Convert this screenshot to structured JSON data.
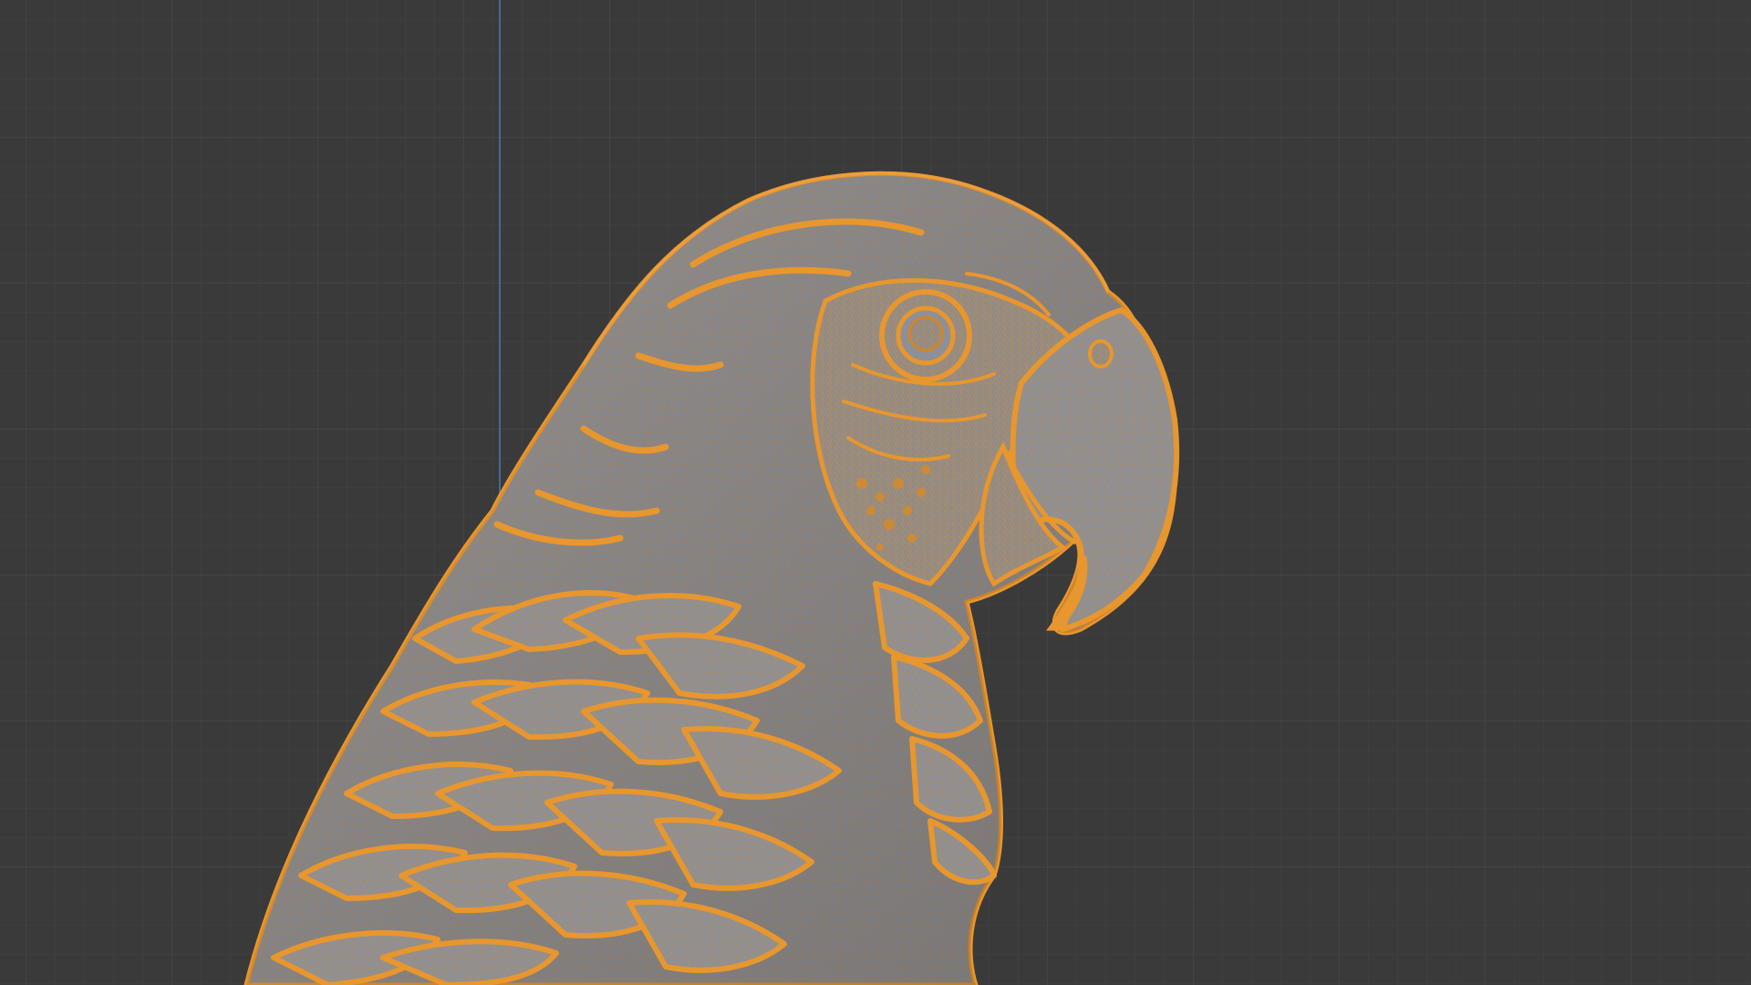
{
  "app": {
    "view_mode": "wireframe-overlay",
    "editor": "3d-viewport"
  },
  "scene": {
    "object": {
      "icon": "parrot-sculpture-mesh",
      "selected": true,
      "state": "active-selection"
    },
    "grid": {
      "visible": true
    },
    "axis": {
      "y_axis_visible": true
    }
  },
  "colors": {
    "background": "#3a3a3a",
    "grid_minor": "#414141",
    "grid_major": "#4a4a4a",
    "axis_y": "#4a78b4",
    "mesh_fill": "#8c8f96",
    "mesh_shade": "#6f7279",
    "wire_selected": "#e8962e",
    "wire_dense": "#d38526"
  }
}
